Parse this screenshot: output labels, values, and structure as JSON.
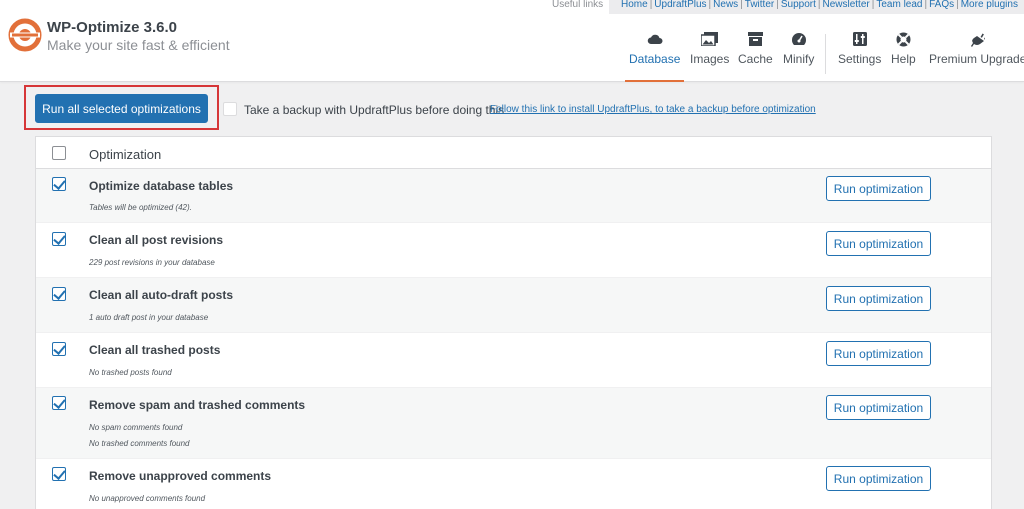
{
  "app": {
    "title": "WP-Optimize 3.6.0",
    "tagline": "Make your site fast & efficient",
    "colors": {
      "accent": "#2271b1",
      "brand_orange": "#e2703a",
      "highlight": "#d63638"
    }
  },
  "useful_links": {
    "label": "Useful links",
    "links": [
      "Home",
      "UpdraftPlus",
      "News",
      "Twitter",
      "Support",
      "Newsletter",
      "Team lead",
      "FAQs",
      "More plugins"
    ]
  },
  "nav": {
    "tabs": [
      {
        "label": "Database",
        "icon": "cloud-icon",
        "active": true
      },
      {
        "label": "Images",
        "icon": "images-icon",
        "active": false
      },
      {
        "label": "Cache",
        "icon": "archive-icon",
        "active": false
      },
      {
        "label": "Minify",
        "icon": "dashboard-icon",
        "active": false
      },
      {
        "label": "Settings",
        "icon": "settings-icon",
        "active": false
      },
      {
        "label": "Help",
        "icon": "lifebuoy-icon",
        "active": false
      },
      {
        "label": "Premium Upgrade",
        "icon": "plugin-icon",
        "active": false
      }
    ]
  },
  "toolbar": {
    "run_all_label": "Run all selected optimizations",
    "backup_label": "Take a backup with UpdraftPlus before doing this",
    "backup_link": "Follow this link to install UpdraftPlus, to take a backup before optimization"
  },
  "table": {
    "header": "Optimization",
    "run_label": "Run optimization",
    "rows": [
      {
        "title": "Optimize database tables",
        "desc": [
          "Tables will be optimized (42)."
        ],
        "checked": true
      },
      {
        "title": "Clean all post revisions",
        "desc": [
          "229 post revisions in your database"
        ],
        "checked": true
      },
      {
        "title": "Clean all auto-draft posts",
        "desc": [
          "1 auto draft post in your database"
        ],
        "checked": true
      },
      {
        "title": "Clean all trashed posts",
        "desc": [
          "No trashed posts found"
        ],
        "checked": true
      },
      {
        "title": "Remove spam and trashed comments",
        "desc": [
          "No spam comments found",
          "No trashed comments found"
        ],
        "checked": true
      },
      {
        "title": "Remove unapproved comments",
        "desc": [
          "No unapproved comments found"
        ],
        "checked": true
      }
    ]
  }
}
